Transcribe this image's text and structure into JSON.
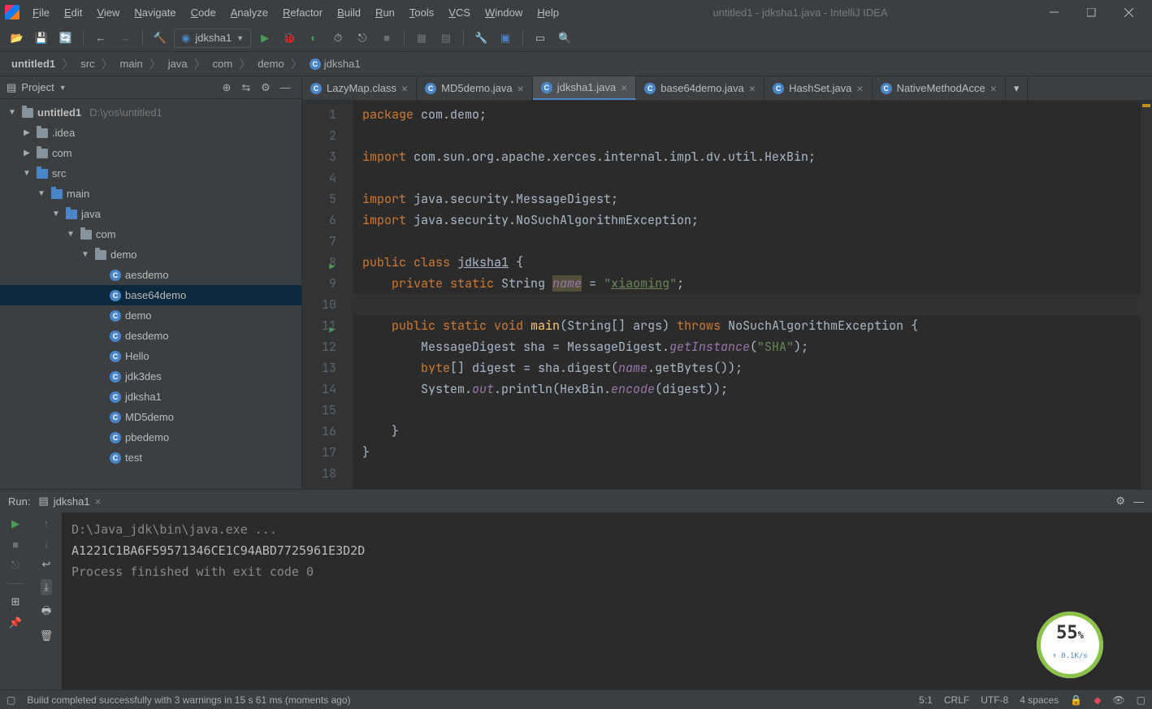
{
  "window": {
    "title": "untitled1 - jdksha1.java - IntelliJ IDEA"
  },
  "menu": [
    "File",
    "Edit",
    "View",
    "Navigate",
    "Code",
    "Analyze",
    "Refactor",
    "Build",
    "Run",
    "Tools",
    "VCS",
    "Window",
    "Help"
  ],
  "runConfig": "jdksha1",
  "breadcrumb": [
    "untitled1",
    "src",
    "main",
    "java",
    "com",
    "demo",
    "jdksha1"
  ],
  "projectPanel": {
    "title": "Project"
  },
  "tree": {
    "root": {
      "name": "untitled1",
      "path": "D:\\yos\\untitled1"
    },
    "nodes": [
      {
        "indent": 1,
        "arrow": "▶",
        "icon": "folder",
        "label": ".idea"
      },
      {
        "indent": 1,
        "arrow": "▶",
        "icon": "folder",
        "label": "com"
      },
      {
        "indent": 1,
        "arrow": "▼",
        "icon": "folder-blue",
        "label": "src"
      },
      {
        "indent": 2,
        "arrow": "▼",
        "icon": "folder-blue",
        "label": "main"
      },
      {
        "indent": 3,
        "arrow": "▼",
        "icon": "folder-blue",
        "label": "java"
      },
      {
        "indent": 4,
        "arrow": "▼",
        "icon": "folder",
        "label": "com"
      },
      {
        "indent": 5,
        "arrow": "▼",
        "icon": "folder",
        "label": "demo"
      },
      {
        "indent": 6,
        "arrow": "",
        "icon": "class",
        "label": "aesdemo"
      },
      {
        "indent": 6,
        "arrow": "",
        "icon": "class",
        "label": "base64demo",
        "selected": true
      },
      {
        "indent": 6,
        "arrow": "",
        "icon": "class",
        "label": "demo"
      },
      {
        "indent": 6,
        "arrow": "",
        "icon": "class",
        "label": "desdemo"
      },
      {
        "indent": 6,
        "arrow": "",
        "icon": "class",
        "label": "Hello"
      },
      {
        "indent": 6,
        "arrow": "",
        "icon": "class",
        "label": "jdk3des"
      },
      {
        "indent": 6,
        "arrow": "",
        "icon": "class",
        "label": "jdksha1"
      },
      {
        "indent": 6,
        "arrow": "",
        "icon": "class",
        "label": "MD5demo"
      },
      {
        "indent": 6,
        "arrow": "",
        "icon": "class",
        "label": "pbedemo"
      },
      {
        "indent": 6,
        "arrow": "",
        "icon": "class",
        "label": "test"
      }
    ]
  },
  "tabs": [
    {
      "label": "LazyMap.class"
    },
    {
      "label": "MD5demo.java"
    },
    {
      "label": "jdksha1.java",
      "active": true
    },
    {
      "label": "base64demo.java"
    },
    {
      "label": "HashSet.java"
    },
    {
      "label": "NativeMethodAcce"
    }
  ],
  "code": {
    "lines": [
      {
        "n": 1,
        "html": "<span class='kw'>package</span> <span class='pkg'>com.demo</span>;"
      },
      {
        "n": 2,
        "html": ""
      },
      {
        "n": 3,
        "html": "<span class='kw'>import</span> <span class='pkg'>com.sun.org.apache.xerces.internal.impl.dv.util.HexBin</span>;"
      },
      {
        "n": 4,
        "html": ""
      },
      {
        "n": 5,
        "html": "<span class='kw'>import</span> <span class='pkg'>java.security.MessageDigest</span>;"
      },
      {
        "n": 6,
        "html": "<span class='kw'>import</span> <span class='pkg'>java.security.NoSuchAlgorithmException</span>;"
      },
      {
        "n": 7,
        "html": ""
      },
      {
        "n": 8,
        "html": "<span class='kw'>public class</span> <span class='ident'><u>jdksha1</u></span> {",
        "run": true
      },
      {
        "n": 9,
        "html": "    <span class='kw'>private static</span> String <span class='field warn'>name</span> = <span class='str'>\"<u>xiaoming</u>\"</span>;"
      },
      {
        "n": 10,
        "html": ""
      },
      {
        "n": 11,
        "html": "    <span class='kw'>public static void</span> <span class='fn'>main</span>(String[] args) <span class='kw'>throws</span> NoSuchAlgorithmException {",
        "run": true
      },
      {
        "n": 12,
        "html": "        MessageDigest sha = MessageDigest.<span class='field'>getInstance</span>(<span class='str'>\"SHA\"</span>);"
      },
      {
        "n": 13,
        "html": "        <span class='kw'>byte</span>[] digest = sha.digest(<span class='field'>name</span>.getBytes());"
      },
      {
        "n": 14,
        "html": "        System.<span class='field'>out</span>.println(HexBin.<span class='field'>encode</span>(digest));"
      },
      {
        "n": 15,
        "html": ""
      },
      {
        "n": 16,
        "html": "    }"
      },
      {
        "n": 17,
        "html": "}"
      },
      {
        "n": 18,
        "html": ""
      }
    ]
  },
  "run": {
    "title": "Run:",
    "config": "jdksha1",
    "output": [
      {
        "cls": "",
        "text": "D:\\Java_jdk\\bin\\java.exe ..."
      },
      {
        "cls": "white",
        "text": "A1221C1BA6F59571346CE1C94ABD7725961E3D2D"
      },
      {
        "cls": "",
        "text": ""
      },
      {
        "cls": "",
        "text": "Process finished with exit code 0"
      }
    ]
  },
  "status": {
    "msg": "Build completed successfully with 3 warnings in 15 s 61 ms (moments ago)",
    "pos": "5:1",
    "eol": "CRLF",
    "enc": "UTF-8",
    "indent": "4 spaces"
  },
  "speed": {
    "pct": "55",
    "rate": "0.1K/s"
  }
}
